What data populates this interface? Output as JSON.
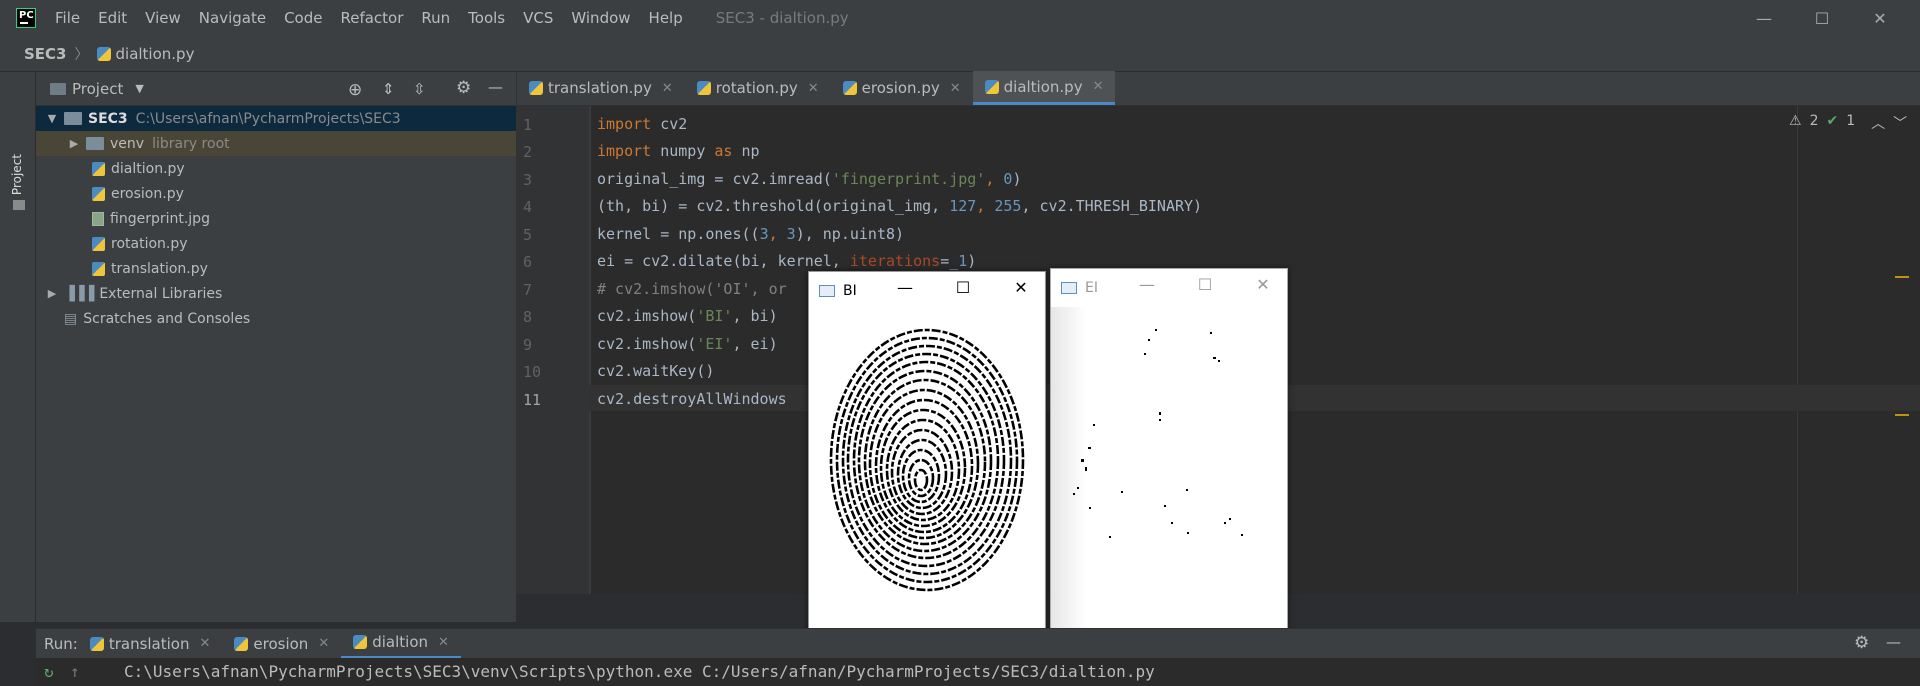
{
  "menu": [
    "File",
    "Edit",
    "View",
    "Navigate",
    "Code",
    "Refactor",
    "Run",
    "Tools",
    "VCS",
    "Window",
    "Help"
  ],
  "window_title": "SEC3 - dialtion.py",
  "breadcrumb": {
    "project": "SEC3",
    "file": "dialtion.py"
  },
  "run_config": "dialtion",
  "project_panel": {
    "title": "Project",
    "vertical_tab": "Project"
  },
  "tree": {
    "root_name": "SEC3",
    "root_path": "C:\\Users\\afnan\\PycharmProjects\\SEC3",
    "venv": "venv",
    "venv_note": "library root",
    "files": [
      "dialtion.py",
      "erosion.py",
      "fingerprint.jpg",
      "rotation.py",
      "translation.py"
    ],
    "ext_libs": "External Libraries",
    "scratches": "Scratches and Consoles"
  },
  "tabs": [
    "translation.py",
    "rotation.py",
    "erosion.py",
    "dialtion.py"
  ],
  "line_numbers": [
    "1",
    "2",
    "3",
    "4",
    "5",
    "6",
    "7",
    "8",
    "9",
    "10",
    "11"
  ],
  "code": {
    "l1a": "import",
    "l1b": " cv2",
    "l2a": "import",
    "l2b": " numpy ",
    "l2c": "as",
    "l2d": " np",
    "l3a": "original_img = cv2.imread(",
    "l3b": "'fingerprint.jpg'",
    "l3c": ", ",
    "l3d": "0",
    "l3e": ")",
    "l4a": "(th, bi) = cv2.threshold(original_img, ",
    "l4b": "127",
    "l4c": ", ",
    "l4d": "255",
    "l4e": ", cv2.THRESH_BINARY)",
    "l5a": "kernel = np.ones((",
    "l5b": "3",
    "l5c": ", ",
    "l5d": "3",
    "l5e": "), np.uint8)",
    "l6a": "ei = cv2.dilate(bi, kernel, ",
    "l6b": "iterations",
    "l6c": "=_",
    "l6d": "1",
    "l6e": ")",
    "l7": "# cv2.imshow('OI', or",
    "l8a": "cv2.imshow(",
    "l8b": "'BI'",
    "l8c": ", bi)",
    "l9a": "cv2.imshow(",
    "l9b": "'EI'",
    "l9c": ", ei)",
    "l10": "cv2.waitKey()",
    "l11": "cv2.destroyAllWindows"
  },
  "inspections": {
    "warnings": "2",
    "ok": "1"
  },
  "cv_windows": [
    {
      "title": "BI"
    },
    {
      "title": "EI"
    }
  ],
  "run": {
    "label": "Run:",
    "tabs": [
      "translation",
      "erosion",
      "dialtion"
    ]
  },
  "console_line": "C:\\Users\\afnan\\PycharmProjects\\SEC3\\venv\\Scripts\\python.exe C:/Users/afnan/PycharmProjects/SEC3/dialtion.py",
  "colors": {
    "keyword": "#cc7832",
    "string": "#6a8759",
    "number": "#6897bb",
    "comment": "#808080",
    "selection": "#0d293e"
  }
}
